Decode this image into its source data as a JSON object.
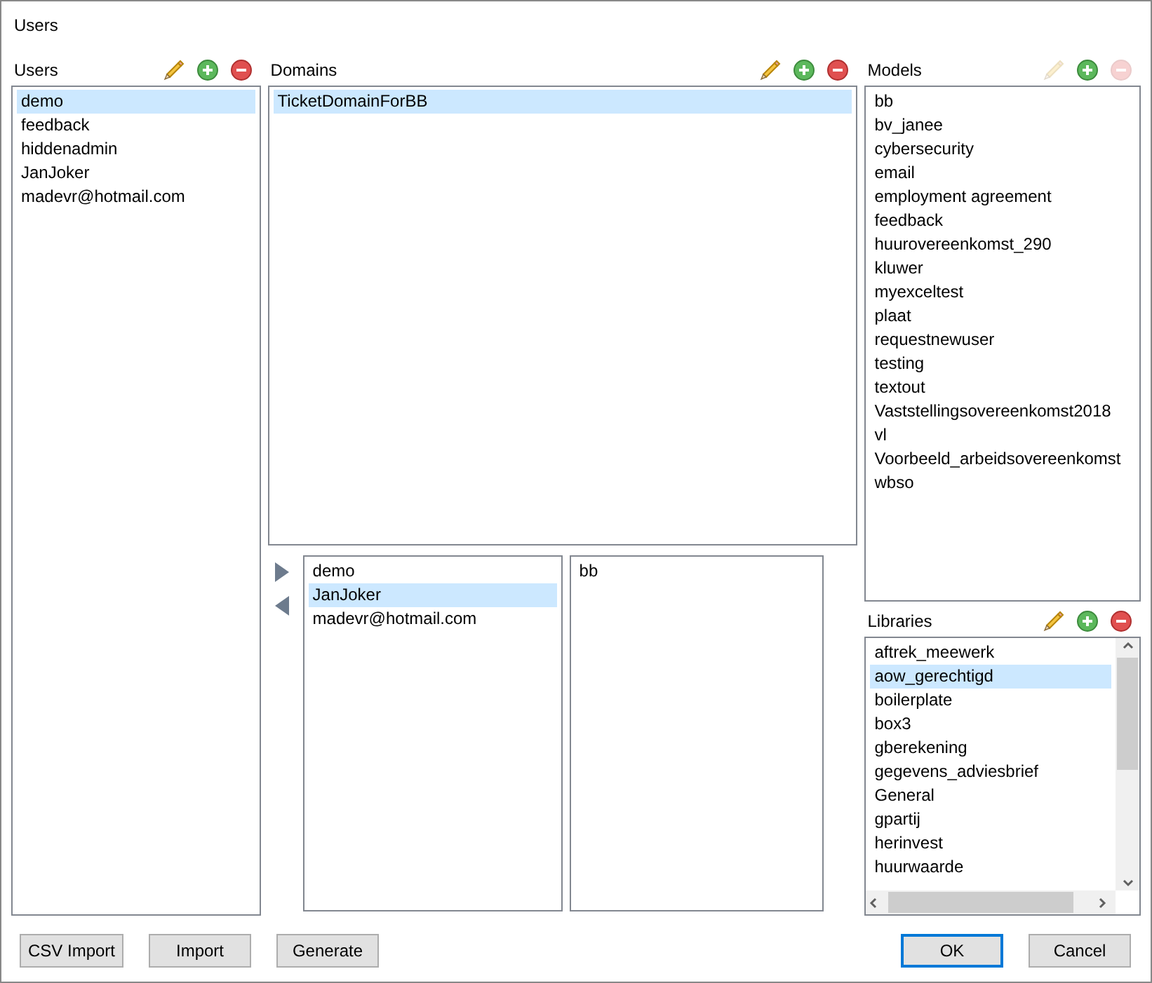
{
  "window": {
    "title": "Users"
  },
  "users": {
    "label": "Users",
    "tools": [
      {
        "kind": "edit",
        "disabled": false
      },
      {
        "kind": "add",
        "disabled": false
      },
      {
        "kind": "remove",
        "disabled": false
      }
    ],
    "items": [
      {
        "text": "demo",
        "selected": true
      },
      {
        "text": "feedback",
        "selected": false
      },
      {
        "text": "hiddenadmin",
        "selected": false
      },
      {
        "text": "JanJoker",
        "selected": false
      },
      {
        "text": "madevr@hotmail.com",
        "selected": false
      }
    ]
  },
  "domains": {
    "label": "Domains",
    "tools": [
      {
        "kind": "edit",
        "disabled": false
      },
      {
        "kind": "add",
        "disabled": false
      },
      {
        "kind": "remove",
        "disabled": false
      }
    ],
    "items": [
      {
        "text": "TicketDomainForBB",
        "selected": true
      }
    ]
  },
  "move_buttons": [
    {
      "kind": "right"
    },
    {
      "kind": "left"
    }
  ],
  "domain_users": {
    "items": [
      {
        "text": "demo",
        "selected": false
      },
      {
        "text": "JanJoker",
        "selected": true
      },
      {
        "text": "madevr@hotmail.com",
        "selected": false
      }
    ]
  },
  "domain_models": {
    "items": [
      {
        "text": "bb",
        "selected": false
      }
    ]
  },
  "models": {
    "label": "Models",
    "tools": [
      {
        "kind": "edit",
        "disabled": true
      },
      {
        "kind": "add",
        "disabled": false
      },
      {
        "kind": "remove",
        "disabled": true
      }
    ],
    "items": [
      {
        "text": "bb",
        "selected": false
      },
      {
        "text": "bv_janee",
        "selected": false
      },
      {
        "text": "cybersecurity",
        "selected": false
      },
      {
        "text": "email",
        "selected": false
      },
      {
        "text": "employment agreement",
        "selected": false
      },
      {
        "text": "feedback",
        "selected": false
      },
      {
        "text": "huurovereenkomst_290",
        "selected": false
      },
      {
        "text": "kluwer",
        "selected": false
      },
      {
        "text": "myexceltest",
        "selected": false
      },
      {
        "text": "plaat",
        "selected": false
      },
      {
        "text": "requestnewuser",
        "selected": false
      },
      {
        "text": "testing",
        "selected": false
      },
      {
        "text": "textout",
        "selected": false
      },
      {
        "text": "Vaststellingsovereenkomst2018",
        "selected": false
      },
      {
        "text": "vl",
        "selected": false
      },
      {
        "text": "Voorbeeld_arbeidsovereenkomst",
        "selected": false
      },
      {
        "text": "wbso",
        "selected": false
      }
    ]
  },
  "libraries": {
    "label": "Libraries",
    "tools": [
      {
        "kind": "edit",
        "disabled": false
      },
      {
        "kind": "add",
        "disabled": false
      },
      {
        "kind": "remove",
        "disabled": false
      }
    ],
    "items": [
      {
        "text": "aftrek_meewerk",
        "selected": false
      },
      {
        "text": "aow_gerechtigd",
        "selected": true
      },
      {
        "text": "boilerplate",
        "selected": false
      },
      {
        "text": "box3",
        "selected": false
      },
      {
        "text": "gberekening",
        "selected": false
      },
      {
        "text": "gegevens_adviesbrief",
        "selected": false
      },
      {
        "text": "General",
        "selected": false
      },
      {
        "text": "gpartij",
        "selected": false
      },
      {
        "text": "herinvest",
        "selected": false
      },
      {
        "text": "huurwaarde",
        "selected": false
      }
    ]
  },
  "left_buttons": [
    {
      "label": "CSV Import",
      "default": false
    },
    {
      "label": "Import",
      "default": false
    },
    {
      "label": "Generate",
      "default": false
    }
  ],
  "right_buttons": [
    {
      "label": "OK",
      "default": true
    },
    {
      "label": "Cancel",
      "default": false
    }
  ]
}
